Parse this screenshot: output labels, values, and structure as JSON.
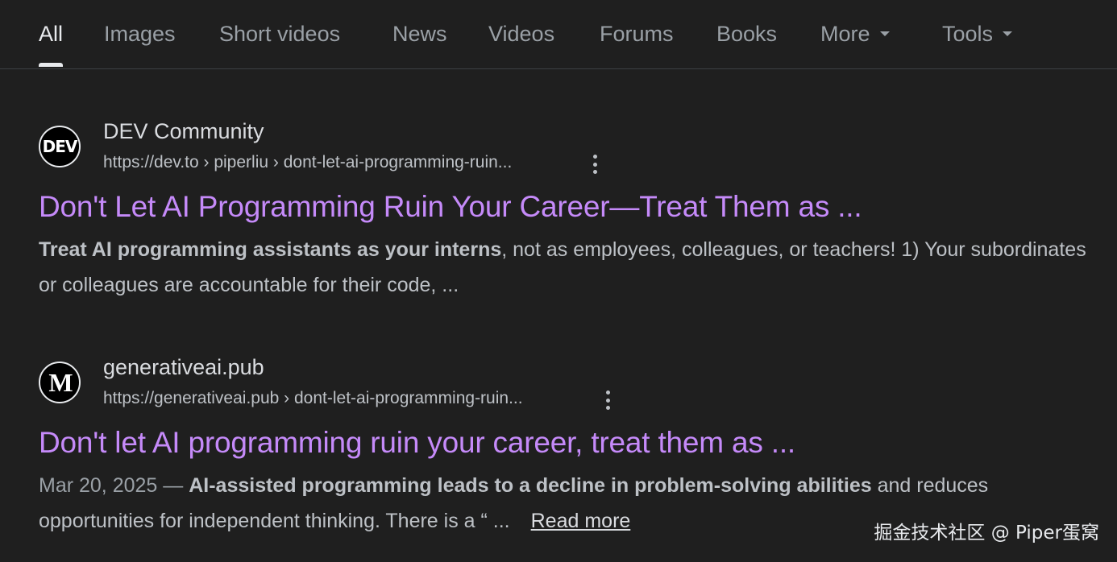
{
  "tabs": [
    {
      "label": "All",
      "active": true
    },
    {
      "label": "Images"
    },
    {
      "label": "Short videos"
    },
    {
      "label": "News"
    },
    {
      "label": "Videos"
    },
    {
      "label": "Forums"
    },
    {
      "label": "Books"
    },
    {
      "label": "More",
      "dropdown": true
    },
    {
      "label": "Tools",
      "dropdown": true
    }
  ],
  "results": [
    {
      "favicon_text": "DEV",
      "site_name": "DEV Community",
      "url": "https://dev.to › piperliu › dont-let-ai-programming-ruin...",
      "title": "Don't Let AI Programming Ruin Your Career—Treat Them as ...",
      "snippet_bold": "Treat AI programming assistants as your interns",
      "snippet_rest": ", not as employees, colleagues, or teachers! 1) Your subordinates or colleagues are accountable for their code, ..."
    },
    {
      "favicon_text": "M",
      "site_name": "generativeai.pub",
      "url": "https://generativeai.pub › dont-let-ai-programming-ruin...",
      "title": "Don't let AI programming ruin your career, treat them as ...",
      "date": "Mar 20, 2025 — ",
      "snippet_bold": "AI-assisted programming leads to a decline in problem-solving abilities",
      "snippet_rest": " and reduces opportunities for independent thinking. There is a “ ...",
      "read_more": "Read more"
    }
  ],
  "watermark": "掘金技术社区 @ Piper蛋窝",
  "colors": {
    "background": "#1f1f1f",
    "link_title": "#c58af9",
    "text": "#bdc1c6"
  }
}
